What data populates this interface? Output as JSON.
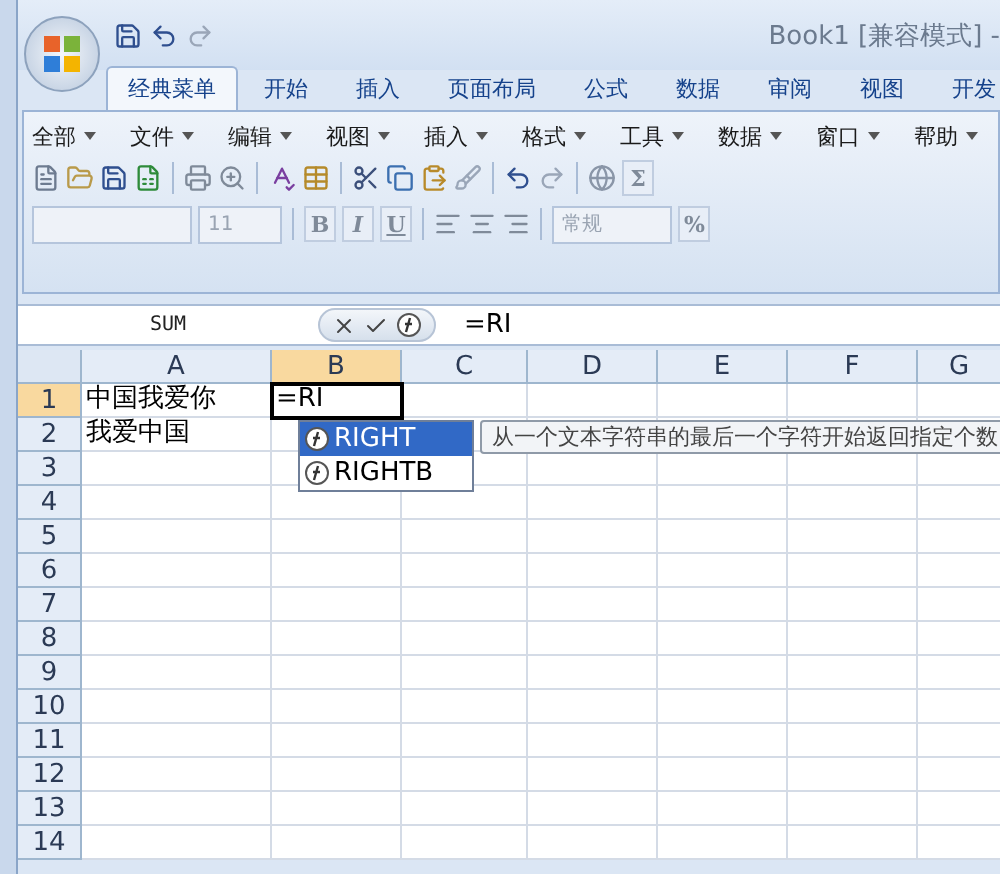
{
  "window": {
    "title": "Book1 [兼容模式] -"
  },
  "ribbon_tabs": [
    {
      "label": "经典菜单",
      "selected": true
    },
    {
      "label": "开始",
      "selected": false
    },
    {
      "label": "插入",
      "selected": false
    },
    {
      "label": "页面布局",
      "selected": false
    },
    {
      "label": "公式",
      "selected": false
    },
    {
      "label": "数据",
      "selected": false
    },
    {
      "label": "审阅",
      "selected": false
    },
    {
      "label": "视图",
      "selected": false
    },
    {
      "label": "开发",
      "selected": false
    }
  ],
  "classic_menu": [
    "全部",
    "文件",
    "编辑",
    "视图",
    "插入",
    "格式",
    "工具",
    "数据",
    "窗口",
    "帮助"
  ],
  "toolbar": {
    "font_size": "11",
    "format_buttons": [
      "B",
      "I",
      "U"
    ],
    "number_format": "常规",
    "sum": "Σ",
    "percent": "%"
  },
  "formula_bar": {
    "name_box": "SUM",
    "formula": "=RI"
  },
  "columns": [
    {
      "label": "A",
      "selected": false
    },
    {
      "label": "B",
      "selected": true
    },
    {
      "label": "C",
      "selected": false
    },
    {
      "label": "D",
      "selected": false
    },
    {
      "label": "E",
      "selected": false
    },
    {
      "label": "F",
      "selected": false
    },
    {
      "label": "G",
      "selected": false
    }
  ],
  "rows": [
    {
      "label": "1",
      "selected": true,
      "cells": [
        {
          "text": "中国我爱你",
          "editing": false
        },
        {
          "text": "=RI",
          "editing": true
        }
      ]
    },
    {
      "label": "2",
      "selected": false,
      "cells": [
        {
          "text": "我爱中国",
          "editing": false
        }
      ]
    },
    {
      "label": "3",
      "selected": false,
      "cells": []
    },
    {
      "label": "4",
      "selected": false,
      "cells": []
    },
    {
      "label": "5",
      "selected": false,
      "cells": []
    },
    {
      "label": "6",
      "selected": false,
      "cells": []
    },
    {
      "label": "7",
      "selected": false,
      "cells": []
    },
    {
      "label": "8",
      "selected": false,
      "cells": []
    },
    {
      "label": "9",
      "selected": false,
      "cells": []
    },
    {
      "label": "10",
      "selected": false,
      "cells": []
    },
    {
      "label": "11",
      "selected": false,
      "cells": []
    },
    {
      "label": "12",
      "selected": false,
      "cells": []
    },
    {
      "label": "13",
      "selected": false,
      "cells": []
    },
    {
      "label": "14",
      "selected": false,
      "cells": []
    }
  ],
  "autocomplete": {
    "items": [
      {
        "label": "RIGHT",
        "selected": true
      },
      {
        "label": "RIGHTB",
        "selected": false
      }
    ],
    "tooltip": "从一个文本字符串的最后一个字符开始返回指定个数"
  }
}
